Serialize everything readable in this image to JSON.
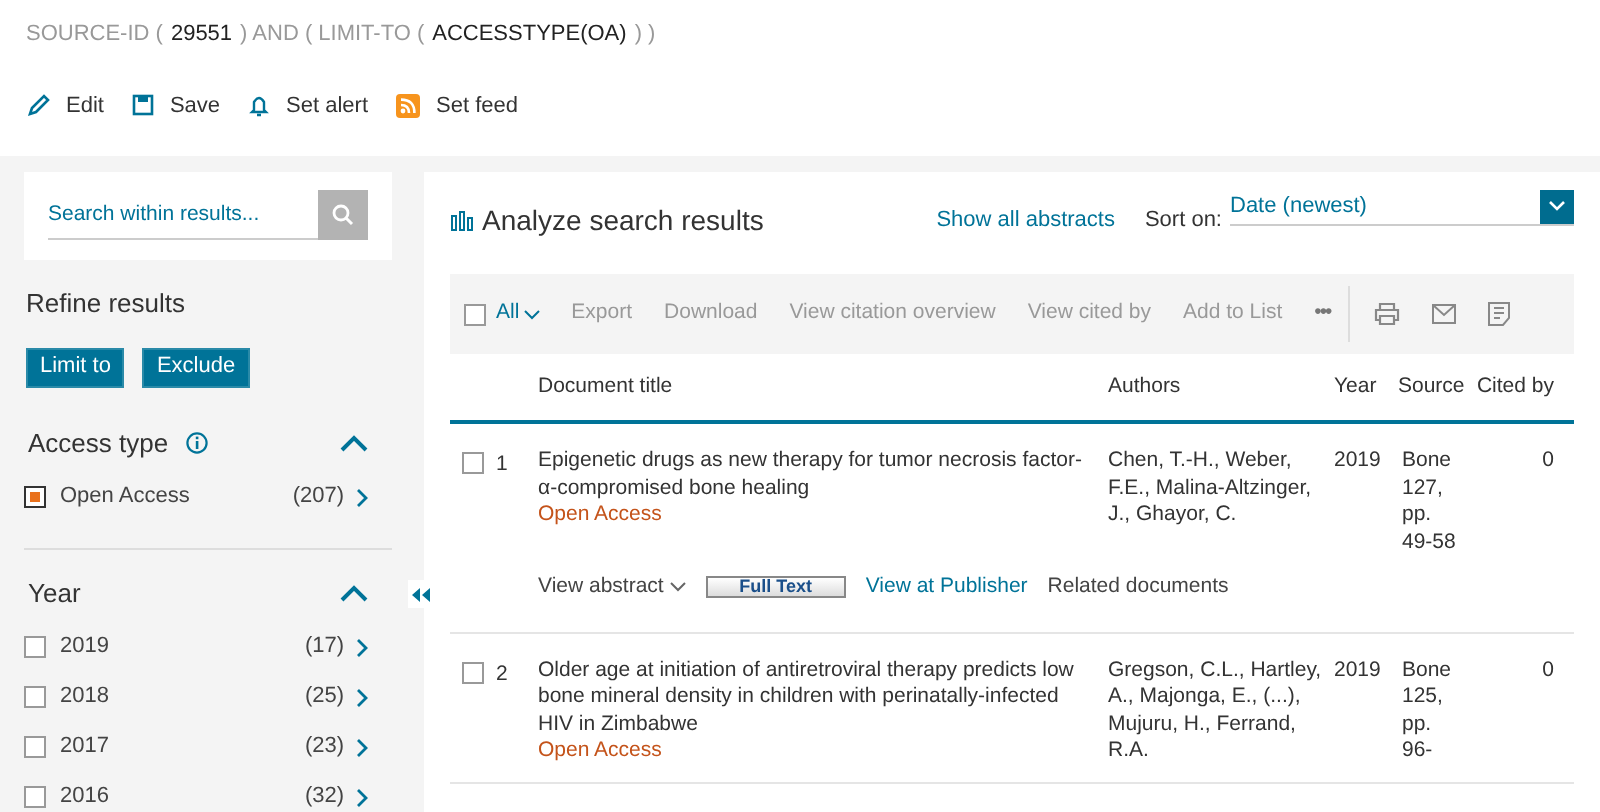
{
  "query": [
    {
      "text": "SOURCE-ID (",
      "kind": "operator"
    },
    {
      "text": "29551",
      "kind": "value"
    },
    {
      "text": ") AND ( LIMIT-TO (",
      "kind": "operator"
    },
    {
      "text": "ACCESSTYPE(OA)",
      "kind": "value"
    },
    {
      "text": ") )",
      "kind": "operator"
    }
  ],
  "actions": [
    {
      "label": "Edit"
    },
    {
      "label": "Save"
    },
    {
      "label": "Set alert"
    },
    {
      "label": "Set feed"
    }
  ],
  "sidebar": {
    "search": {
      "placeholder": "Search within results..."
    },
    "refine_title": "Refine results",
    "buttons": [
      "Limit to",
      "Exclude"
    ],
    "facets": [
      {
        "title": "Access type",
        "info": true,
        "expanded": true,
        "items": [
          {
            "label": "Open Access",
            "count": "(207)",
            "checked": true
          }
        ]
      },
      {
        "title": "Year",
        "expanded": true,
        "items": [
          {
            "label": "2019",
            "count": "(17)",
            "checked": false
          },
          {
            "label": "2018",
            "count": "(25)",
            "checked": false
          },
          {
            "label": "2017",
            "count": "(23)",
            "checked": false
          },
          {
            "label": "2016",
            "count": "(32)",
            "checked": false
          }
        ]
      }
    ]
  },
  "results": {
    "analyze": "Analyze search results",
    "show_abstracts": "Show all abstracts",
    "sort_label": "Sort on:",
    "sort_value": "Date (newest)",
    "toolbar": {
      "all": "All",
      "all_checked": false,
      "actions": [
        "Export",
        "Download",
        "View citation overview",
        "View cited by",
        "Add to List"
      ],
      "more": "•••"
    },
    "columns": [
      "Document title",
      "Authors",
      "Year",
      "Source",
      "Cited by"
    ],
    "rows": [
      {
        "number": "1",
        "checked": false,
        "title": "Epigenetic drugs as new therapy for tumor necrosis factor-α-compromised bone healing",
        "access": "Open Access",
        "authors": "Chen, T.-H., Weber, F.E., Malina-Altzinger, J., Ghayor, C.",
        "year": "2019",
        "source": "Bone 127, pp. 49-58",
        "cited_by": "0",
        "links": {
          "abstract": "View abstract",
          "full_text": "Full Text",
          "publisher": "View at Publisher",
          "related": "Related documents"
        }
      },
      {
        "number": "2",
        "checked": false,
        "title": "Older age at initiation of antiretroviral therapy predicts low bone mineral density in children with perinatally-infected HIV in Zimbabwe",
        "access": "Open Access",
        "authors": "Gregson, C.L., Hartley, A., Majonga, E., (...), Mujuru, H., Ferrand, R.A.",
        "year": "2019",
        "source": "Bone 125, pp. 96-",
        "cited_by": "0"
      }
    ]
  }
}
